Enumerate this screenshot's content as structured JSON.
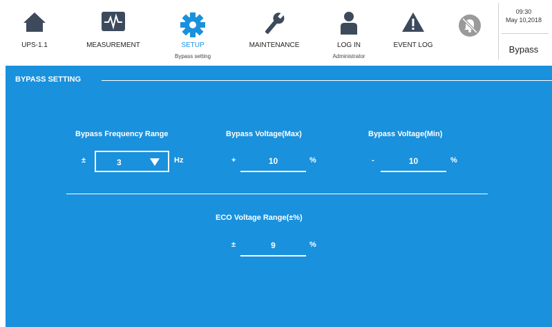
{
  "nav": {
    "ups": {
      "label": "UPS-1.1",
      "icon": "home-icon"
    },
    "measurement": {
      "label": "MEASUREMENT",
      "icon": "waveform-icon"
    },
    "setup": {
      "label": "SETUP",
      "sub": "Bypass setting",
      "icon": "gear-icon"
    },
    "maintenance": {
      "label": "MAINTENANCE",
      "icon": "wrench-icon"
    },
    "login": {
      "label": "LOG IN",
      "sub": "Administrator",
      "icon": "user-icon"
    },
    "eventlog": {
      "label": "EVENT LOG",
      "icon": "warning-icon"
    },
    "mute": {
      "icon": "muted-alarm-icon"
    }
  },
  "status": {
    "time": "09:30",
    "date": "May 10,2018",
    "mode": "Bypass"
  },
  "colors": {
    "accent": "#1a91dc",
    "icon": "#3c4a5c",
    "mute_icon": "#9a9a9a"
  },
  "section": {
    "title": "BYPASS SETTING"
  },
  "freq": {
    "label": "Bypass Frequency Range",
    "sign": "±",
    "value": "3",
    "unit": "Hz"
  },
  "vmax": {
    "label": "Bypass Voltage(Max)",
    "sign": "+",
    "value": "10",
    "unit": "%"
  },
  "vmin": {
    "label": "Bypass Voltage(Min)",
    "sign": "-",
    "value": "10",
    "unit": "%"
  },
  "eco": {
    "label": "ECO Voltage Range(±%)",
    "sign": "±",
    "value": "9",
    "unit": "%"
  }
}
